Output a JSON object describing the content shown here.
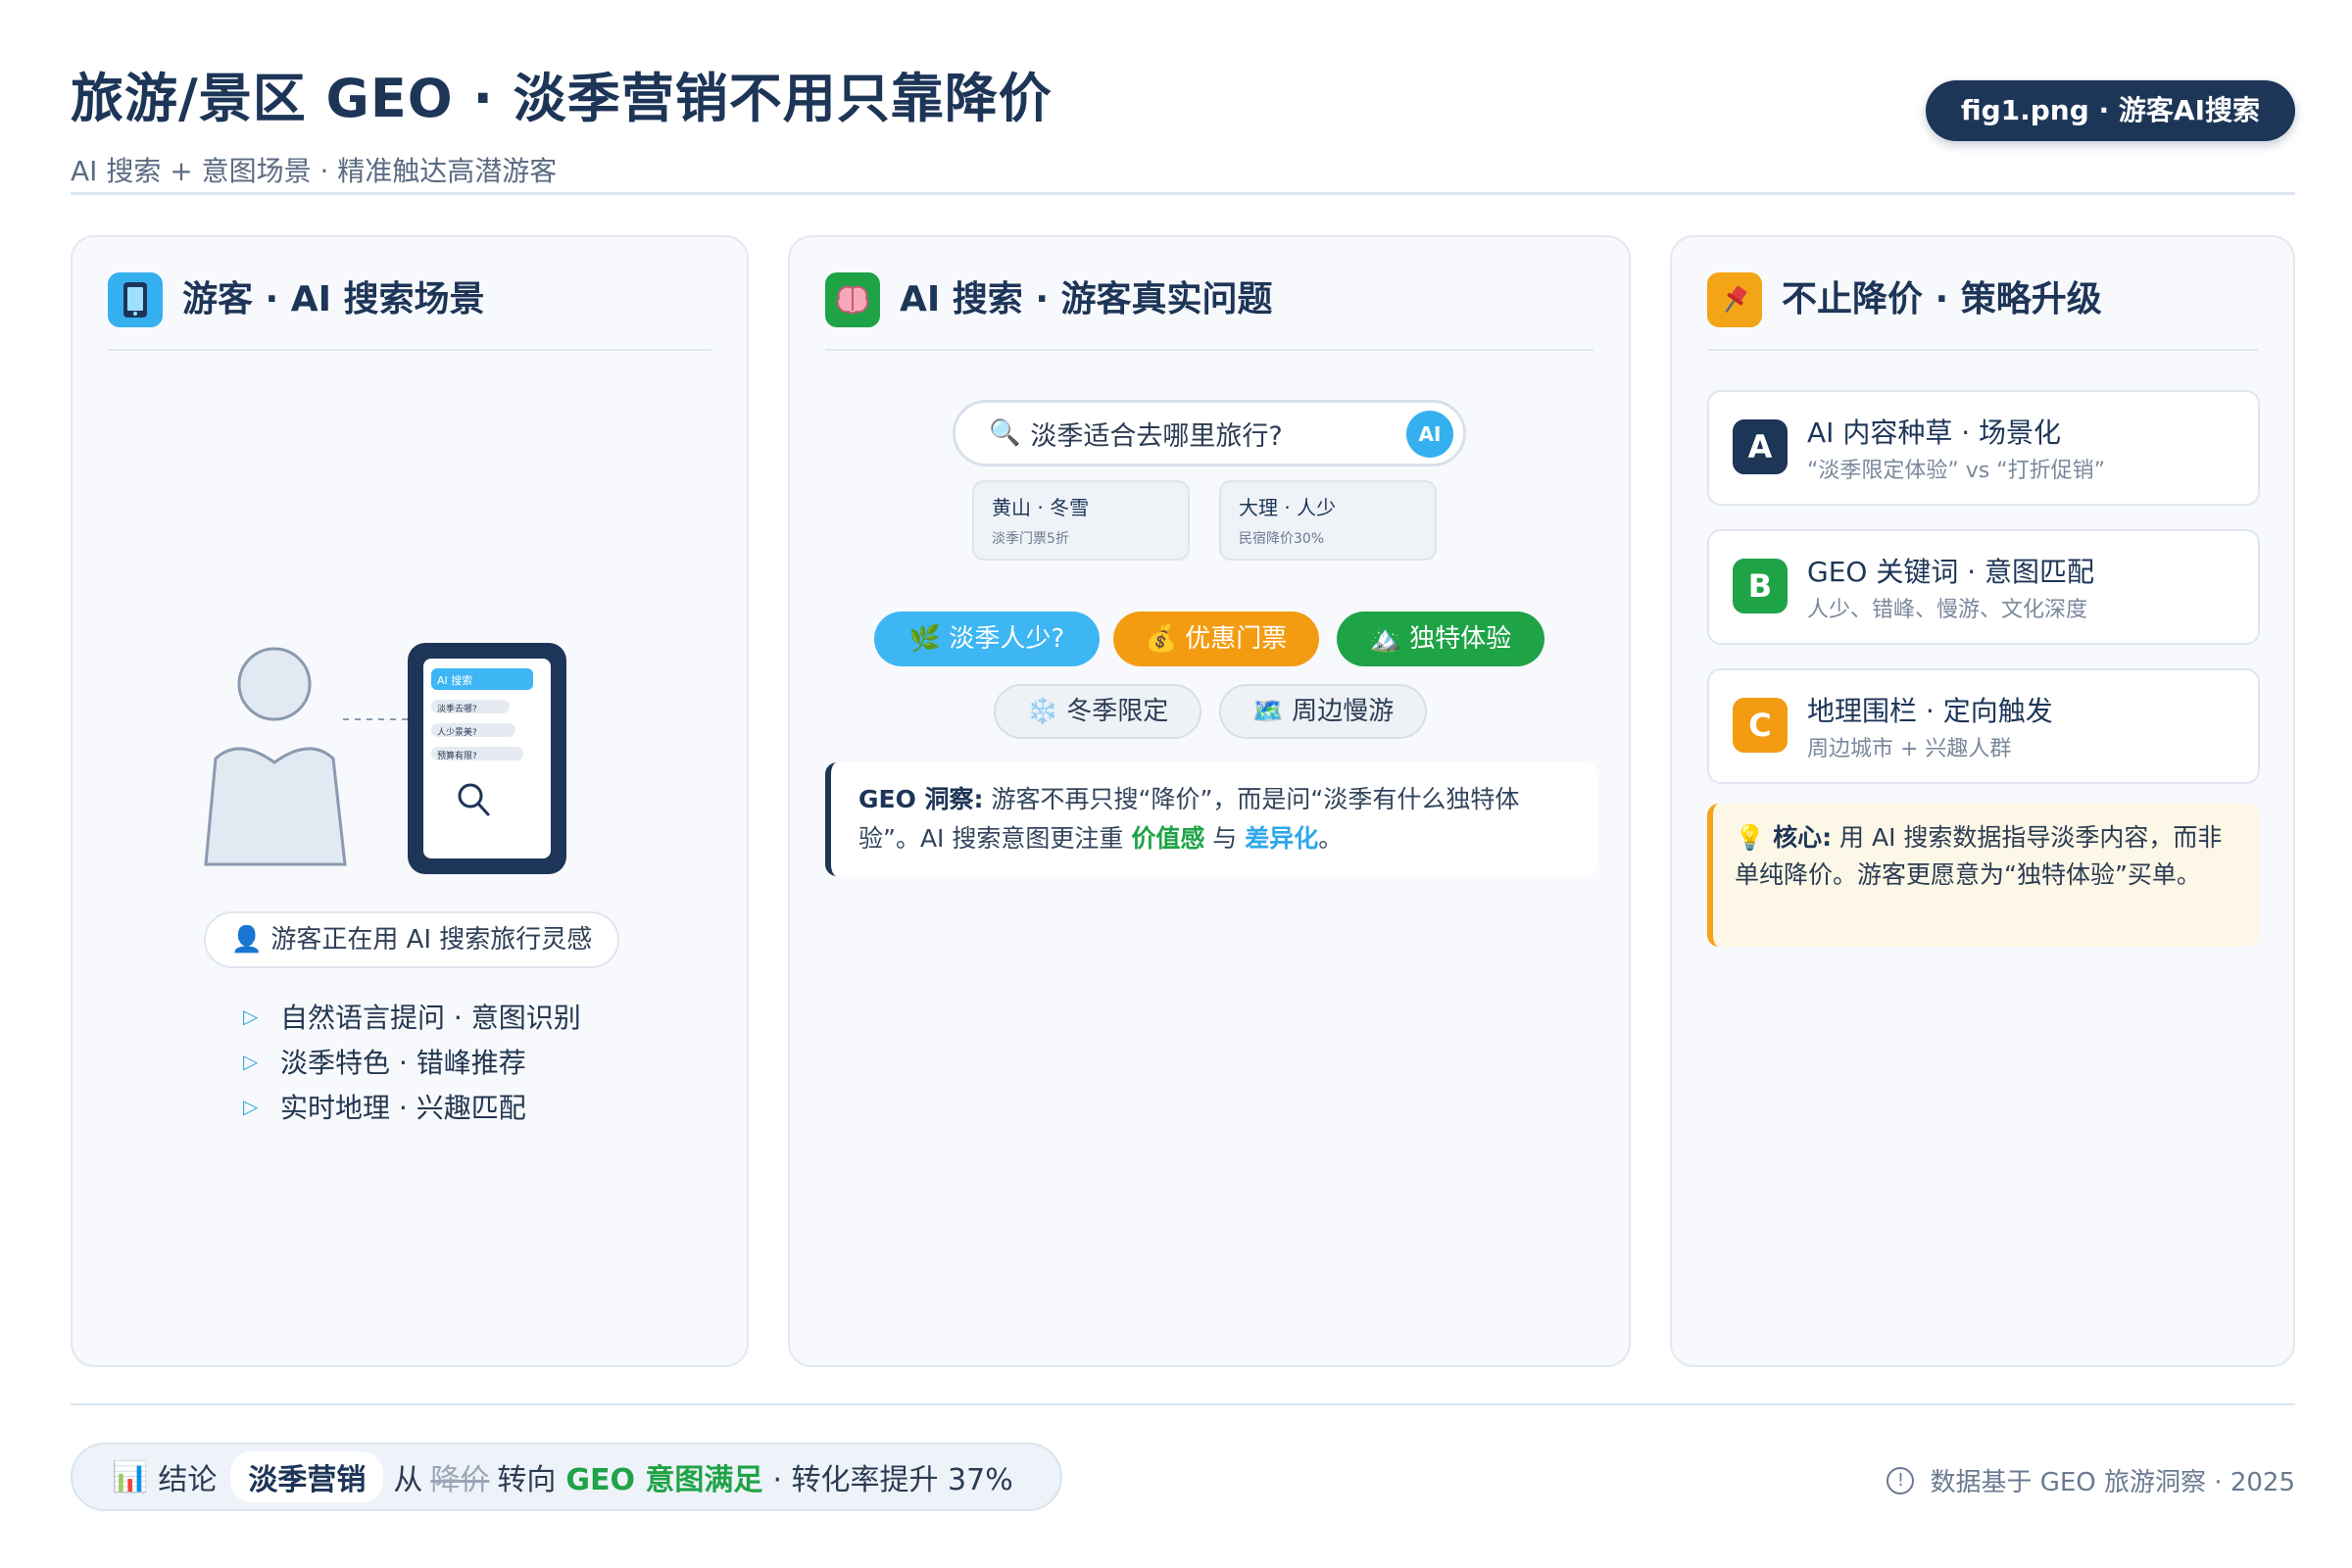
{
  "header": {
    "title": "旅游/景区 GEO · 淡季营销不用只靠降价",
    "subtitle": "AI 搜索 + 意图场景 · 精准触达高潜游客",
    "fig_label": "fig1.png · 游客AI搜索"
  },
  "panel_left": {
    "icon": "phone-icon",
    "title": "游客 · AI 搜索场景",
    "phone": {
      "header": "AI 搜索",
      "lines": [
        "淡季去哪?",
        "人少景美?",
        "预算有限?"
      ]
    },
    "status": "游客正在用 AI 搜索旅行灵感",
    "bullets": [
      "自然语言提问 · 意图识别",
      "淡季特色 · 错峰推荐",
      "实时地理 · 兴趣匹配"
    ]
  },
  "panel_middle": {
    "icon": "brain-icon",
    "title": "AI 搜索 · 游客真实问题",
    "search": {
      "query": "淡季适合去哪里旅行?",
      "badge": "AI"
    },
    "results": [
      {
        "title": "黄山 · 冬雪",
        "sub": "淡季门票5折"
      },
      {
        "title": "大理 · 人少",
        "sub": "民宿降价30%"
      }
    ],
    "chips_row1": [
      "🌿 淡季人少?",
      "💰 优惠门票",
      "🏔️ 独特体验"
    ],
    "chips_row2": [
      "❄️ 冬季限定",
      "🗺️ 周边慢游"
    ],
    "insight": {
      "label": "GEO 洞察:",
      "text1": "游客不再只搜“降价”，而是问“淡季有什么独特体验”。AI 搜索意图更注重 ",
      "highlight1": "价值感",
      "mid": " 与 ",
      "highlight2": "差异化",
      "end": "。"
    }
  },
  "panel_right": {
    "icon": "pin-icon",
    "title": "不止降价 · 策略升级",
    "strategies": [
      {
        "badge": "A",
        "title": "AI 内容种草 · 场景化",
        "sub": "“淡季限定体验” vs “打折促销”",
        "color": "#1d3557"
      },
      {
        "badge": "B",
        "title": "GEO 关键词 · 意图匹配",
        "sub": "人少、错峰、慢游、文化深度",
        "color": "#1fa347"
      },
      {
        "badge": "C",
        "title": "地理围栏 · 定向触发",
        "sub": "周边城市 + 兴趣人群",
        "color": "#f39c12"
      }
    ],
    "core": {
      "label": "核心:",
      "text": "用 AI 搜索数据指导淡季内容，而非单纯降价。游客更愿意为“独特体验”买单。"
    }
  },
  "footer": {
    "icon": "bar-chart-icon",
    "conclusion_prefix": "结论",
    "tag": "淡季营销",
    "from": "从",
    "struck": "降价",
    "to": "转向",
    "highlight": "GEO 意图满足",
    "rest": "· 转化率提升 37%",
    "source": "数据基于 GEO 旅游洞察 · 2025"
  },
  "colors": {
    "navy": "#1d3557",
    "sky": "#3db6f3",
    "orange": "#f39c12",
    "green": "#1fa347",
    "panel_bg": "#f7f9fc"
  }
}
